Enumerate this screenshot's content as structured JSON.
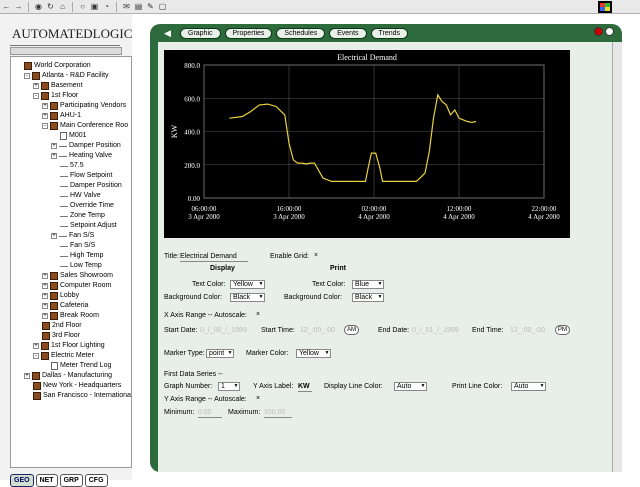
{
  "toolbar": {
    "icons": [
      "back-arrow",
      "forward-arrow",
      "home",
      "refresh",
      "stop",
      "print",
      "search",
      "history",
      "mail",
      "edit",
      "new",
      "chat"
    ]
  },
  "sidebar": {
    "logo": "AUTOMATEDLOGIC",
    "tree": [
      {
        "label": "World Corporation",
        "depth": 0,
        "icon": "building",
        "exp": ""
      },
      {
        "label": "Atlanta - R&D Facility",
        "depth": 1,
        "icon": "building",
        "exp": "-"
      },
      {
        "label": "Basement",
        "depth": 2,
        "icon": "building",
        "exp": "+"
      },
      {
        "label": "1st Floor",
        "depth": 2,
        "icon": "building",
        "exp": "-"
      },
      {
        "label": "Participating Vendors",
        "depth": 3,
        "icon": "building",
        "exp": "+"
      },
      {
        "label": "AHU-1",
        "depth": 3,
        "icon": "building",
        "exp": "+"
      },
      {
        "label": "Main Conference Roo",
        "depth": 3,
        "icon": "building",
        "exp": "-"
      },
      {
        "label": "M001",
        "depth": 4,
        "icon": "doc",
        "exp": ""
      },
      {
        "label": "Damper Position",
        "depth": 4,
        "icon": "line",
        "exp": "+"
      },
      {
        "label": "Heating Valve",
        "depth": 4,
        "icon": "line",
        "exp": "+"
      },
      {
        "label": "57.5",
        "depth": 4,
        "icon": "line",
        "exp": ""
      },
      {
        "label": "Flow Setpoint",
        "depth": 4,
        "icon": "line",
        "exp": ""
      },
      {
        "label": "Damper Position",
        "depth": 4,
        "icon": "line",
        "exp": ""
      },
      {
        "label": "HW Valve",
        "depth": 4,
        "icon": "line",
        "exp": ""
      },
      {
        "label": "Override Time",
        "depth": 4,
        "icon": "line",
        "exp": ""
      },
      {
        "label": "Zone Temp",
        "depth": 4,
        "icon": "line",
        "exp": ""
      },
      {
        "label": "Setpoint Adjust",
        "depth": 4,
        "icon": "line",
        "exp": ""
      },
      {
        "label": "Fan S/S",
        "depth": 4,
        "icon": "line",
        "exp": "+"
      },
      {
        "label": "Fan S/S",
        "depth": 4,
        "icon": "line",
        "exp": ""
      },
      {
        "label": "High Temp",
        "depth": 4,
        "icon": "line",
        "exp": ""
      },
      {
        "label": "Low Temp",
        "depth": 4,
        "icon": "line",
        "exp": ""
      },
      {
        "label": "Sales Showroom",
        "depth": 3,
        "icon": "building",
        "exp": "+"
      },
      {
        "label": "Computer Room",
        "depth": 3,
        "icon": "building",
        "exp": "+"
      },
      {
        "label": "Lobby",
        "depth": 3,
        "icon": "building",
        "exp": "+"
      },
      {
        "label": "Cafeteria",
        "depth": 3,
        "icon": "building",
        "exp": "+"
      },
      {
        "label": "Break Room",
        "depth": 3,
        "icon": "building",
        "exp": "+"
      },
      {
        "label": "2nd Floor",
        "depth": 2,
        "icon": "building",
        "exp": ""
      },
      {
        "label": "3rd Floor",
        "depth": 2,
        "icon": "building",
        "exp": ""
      },
      {
        "label": "1st Floor Lighting",
        "depth": 2,
        "icon": "building",
        "exp": "+"
      },
      {
        "label": "Electric Meter",
        "depth": 2,
        "icon": "building",
        "exp": "-"
      },
      {
        "label": "Meter Trend Log",
        "depth": 3,
        "icon": "doc",
        "exp": ""
      },
      {
        "label": "Dallas - Manufacturing",
        "depth": 1,
        "icon": "building",
        "exp": "+"
      },
      {
        "label": "New York - Headquarters",
        "depth": 1,
        "icon": "building",
        "exp": ""
      },
      {
        "label": "San Francisco - Internationa",
        "depth": 1,
        "icon": "building",
        "exp": ""
      }
    ],
    "tabs": [
      "GEO",
      "NET",
      "GRP",
      "CFG"
    ]
  },
  "nav": {
    "tabs": [
      "Graphic",
      "Properties",
      "Schedules",
      "Events",
      "Trends"
    ]
  },
  "chart_data": {
    "type": "line",
    "title": "Electrical Demand",
    "ylabel": "KW",
    "ylim": [
      0,
      800
    ],
    "yticks": [
      "800.0",
      "600.0",
      "400.0",
      "200.0",
      "0.00"
    ],
    "xticks": [
      {
        "t": "06:00:00",
        "d": "3 Apr 2000"
      },
      {
        "t": "16:00:00",
        "d": "3 Apr 2000"
      },
      {
        "t": "02:00:00",
        "d": "4 Apr 2000"
      },
      {
        "t": "12:00:00",
        "d": "4 Apr 2000"
      },
      {
        "t": "22:00:00",
        "d": "4 Apr 2000"
      }
    ],
    "x_hours": [
      0,
      10,
      20,
      30,
      40
    ],
    "series": [
      {
        "color": "#e8d13a",
        "x": [
          3,
          4.5,
          5.5,
          6.5,
          7.5,
          8.5,
          9.5,
          10,
          10.5,
          11,
          11.5,
          12,
          12.5,
          13,
          14,
          15,
          16,
          17,
          18,
          19,
          19.3,
          19.7,
          20.2,
          20.7,
          21,
          22,
          23,
          24,
          25,
          26,
          26.5,
          27,
          27.5,
          28,
          28.5,
          29,
          29.5,
          30,
          30.5,
          31,
          31.5,
          32
        ],
        "y": [
          480,
          490,
          520,
          560,
          565,
          550,
          500,
          330,
          230,
          210,
          210,
          205,
          210,
          210,
          120,
          100,
          100,
          100,
          100,
          100,
          180,
          270,
          270,
          180,
          100,
          100,
          100,
          100,
          100,
          150,
          280,
          480,
          620,
          580,
          560,
          500,
          530,
          480,
          470,
          460,
          455,
          460
        ]
      }
    ],
    "grid": true,
    "legend": "none"
  },
  "form": {
    "title_label": "Title:",
    "title_value": "Electrical Demand",
    "enable_grid_label": "Enable Grid:",
    "enable_grid_mark": "×",
    "display_header": "Display",
    "print_header": "Print",
    "text_color_label": "Text Color:",
    "bg_color_label": "Background Color:",
    "display_text_color": "Yellow",
    "display_bg_color": "Black",
    "print_text_color": "Blue",
    "print_bg_color": "Black",
    "xrange_label": "X Axis Range -- Autoscale:",
    "xrange_mark": "×",
    "start_date_label": "Start Date:",
    "start_date": "0_/_00_/_1999",
    "start_time_label": "Start Time:",
    "start_time": "12_:00_:00",
    "start_ampm": "AM",
    "end_date_label": "End Date:",
    "end_date": "0_/_01_/_1999",
    "end_time_label": "End Time:",
    "end_time": "12_:00_:00",
    "end_ampm": "PM",
    "marker_type_label": "Marker Type:",
    "marker_type": "point",
    "marker_color_label": "Marker Color:",
    "marker_color": "Yellow",
    "first_series_label": "First Data Series --",
    "graph_number_label": "Graph Number:",
    "graph_number": "1",
    "y_axis_label_label": "Y Axis Label:",
    "y_axis_label": "KW",
    "display_line_color_label": "Display Line Color:",
    "display_line_color": "Auto",
    "print_line_color_label": "Print Line Color:",
    "print_line_color": "Auto",
    "yrange_label": "Y Axis Range -- Autoscale:",
    "yrange_mark": "×",
    "minimum_label": "Minimum:",
    "minimum": "0.00",
    "maximum_label": "Maximum:",
    "maximum": "100.00"
  }
}
